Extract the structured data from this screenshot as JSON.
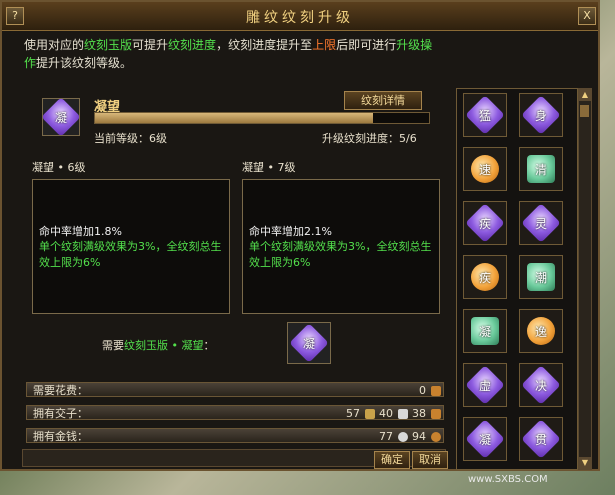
{
  "window": {
    "title": "雕纹纹刻升级",
    "help_label": "?",
    "close_label": "X"
  },
  "description": {
    "p1": "使用对应的",
    "p2": "纹刻玉版",
    "p3": "可提升",
    "p4": "纹刻进度",
    "p5": "，纹刻进度提升至",
    "p6": "上限",
    "p7": "后即可进行",
    "p8": "升级操作",
    "p9": "提升该纹刻等级。"
  },
  "item": {
    "name": "凝望",
    "detail_button": "纹刻详情",
    "current_level": "当前等级：6级",
    "upgrade_progress": "升级纹刻进度：5/6",
    "progress_value": 5,
    "progress_max": 6,
    "icon_char": "凝",
    "icon": "purple-gem-icon"
  },
  "current_panel": {
    "title": "凝望 • 6级",
    "line1": "命中率增加1.8%",
    "line2": "单个纹刻满级效果为3%，全纹刻总生效上限为6%"
  },
  "next_panel": {
    "title": "凝望 • 7级",
    "line1": "命中率增加2.1%",
    "line2": "单个纹刻满级效果为3%，全纹刻总生效上限为6%"
  },
  "need": {
    "prefix": "需要",
    "item": "纹刻玉版 • 凝望",
    "suffix": "：",
    "icon_char": "凝"
  },
  "cost": {
    "label": "需要花费：",
    "value": "0"
  },
  "exchange": {
    "label": "拥有交子：",
    "v1": "57",
    "v2": "40",
    "v3": "38"
  },
  "money": {
    "label": "拥有金钱：",
    "v1": "77",
    "v2": "94"
  },
  "buttons": {
    "ok": "确定",
    "cancel": "取消"
  },
  "side_items": [
    {
      "char": "猛",
      "type": "purple"
    },
    {
      "char": "身",
      "type": "purple"
    },
    {
      "char": "速",
      "type": "orange"
    },
    {
      "char": "清",
      "type": "jade"
    },
    {
      "char": "疾",
      "type": "purple"
    },
    {
      "char": "灵",
      "type": "purple"
    },
    {
      "char": "疾",
      "type": "orange"
    },
    {
      "char": "潮",
      "type": "jade"
    },
    {
      "char": "凝",
      "type": "jade"
    },
    {
      "char": "逸",
      "type": "orange"
    },
    {
      "char": "虚",
      "type": "purple"
    },
    {
      "char": "决",
      "type": "purple"
    },
    {
      "char": "凝",
      "type": "purple"
    },
    {
      "char": "贯",
      "type": "purple"
    }
  ],
  "watermark": "www.SXBS.COM"
}
